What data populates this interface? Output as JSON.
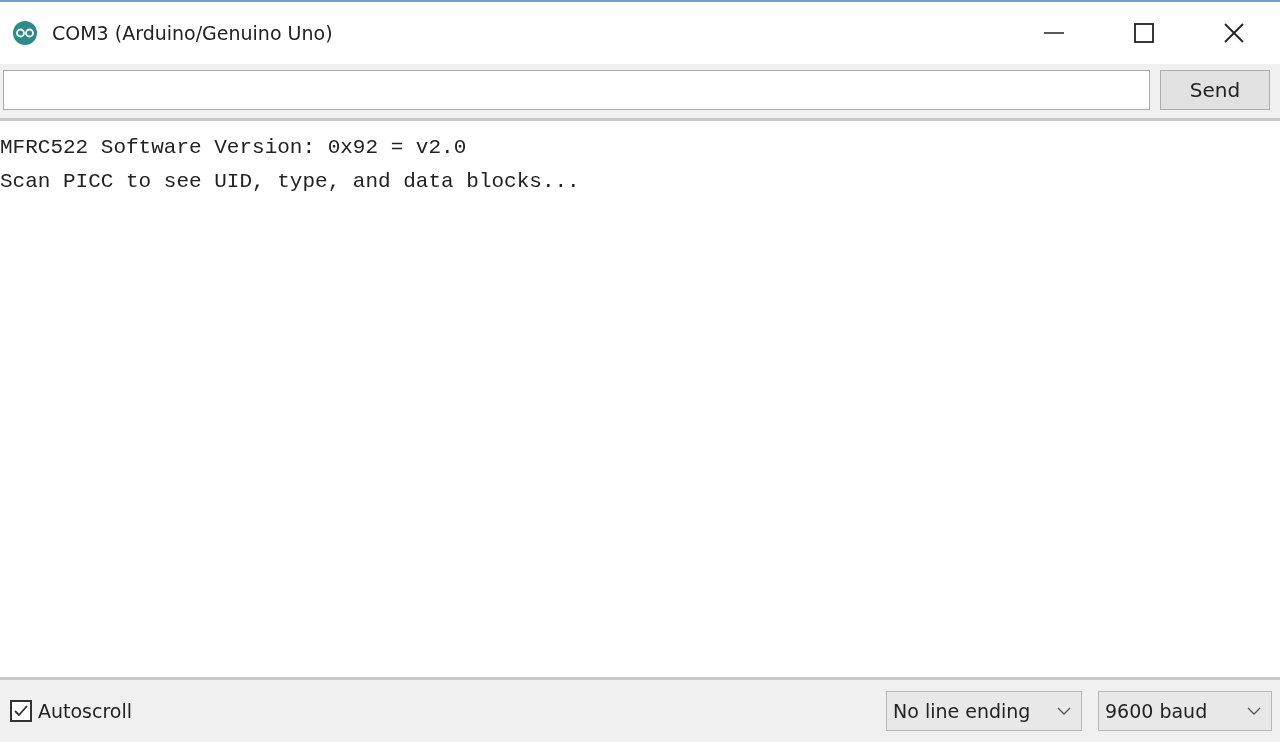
{
  "window": {
    "title": "COM3 (Arduino/Genuino Uno)"
  },
  "send_button": "Send",
  "output_lines": [
    "MFRC522 Software Version: 0x92 = v2.0",
    "Scan PICC to see UID, type, and data blocks..."
  ],
  "autoscroll": {
    "label": "Autoscroll",
    "checked": true
  },
  "line_ending": {
    "value": "No line ending"
  },
  "baud_rate": {
    "value": "9600 baud"
  }
}
